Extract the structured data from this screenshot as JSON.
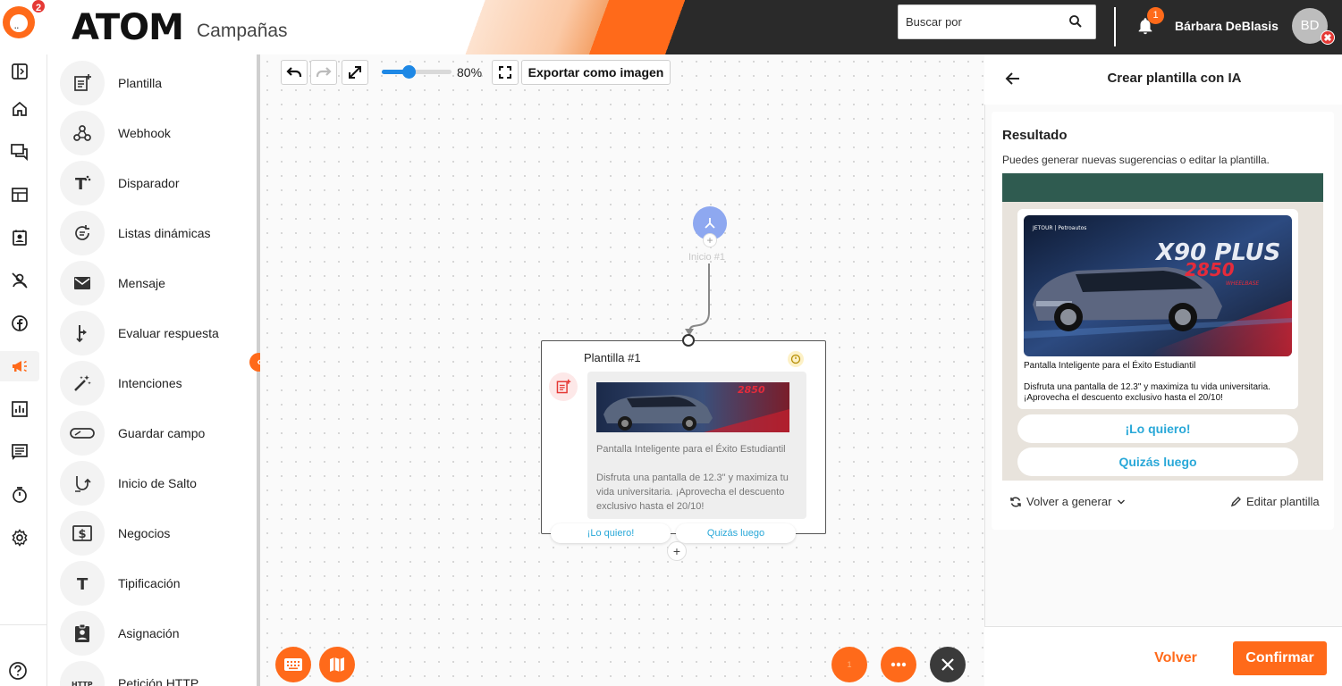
{
  "header": {
    "brand": "ATOM",
    "section": "Campañas",
    "logo_badge_count": "2",
    "search_placeholder": "Buscar por",
    "notification_count": "1",
    "user_name": "Bárbara DeBlasis",
    "user_initials": "BD"
  },
  "rail": {
    "icons": [
      "sidebar-toggle-icon",
      "home-icon",
      "conversations-icon",
      "table-icon",
      "contacts-icon",
      "agents-off-icon",
      "facebook-icon",
      "campaigns-icon",
      "reports-icon",
      "forms-icon",
      "timer-icon",
      "settings-icon",
      "help-icon"
    ],
    "active": "campaigns-icon"
  },
  "palette": {
    "items": [
      {
        "label": "Plantilla",
        "icon": "template-icon"
      },
      {
        "label": "Webhook",
        "icon": "webhook-icon"
      },
      {
        "label": "Disparador",
        "icon": "trigger-icon"
      },
      {
        "label": "Listas dinámicas",
        "icon": "dynamic-list-icon"
      },
      {
        "label": "Mensaje",
        "icon": "mail-icon"
      },
      {
        "label": "Evaluar respuesta",
        "icon": "branch-icon"
      },
      {
        "label": "Intenciones",
        "icon": "magic-wand-icon"
      },
      {
        "label": "Guardar campo",
        "icon": "input-field-icon"
      },
      {
        "label": "Inicio de Salto",
        "icon": "jump-icon"
      },
      {
        "label": "Negocios",
        "icon": "dollar-icon"
      },
      {
        "label": "Tipificación",
        "icon": "text-icon"
      },
      {
        "label": "Asignación",
        "icon": "assignment-icon"
      },
      {
        "label": "Petición HTTP",
        "icon": "http-icon"
      }
    ]
  },
  "toolbar": {
    "zoom_value": 80,
    "zoom_label": "80%",
    "export_label": "Exportar como imagen"
  },
  "canvas": {
    "start_label": "Inicio #1",
    "template_node": {
      "title": "Plantilla #1",
      "heading": "Pantalla Inteligente para el Éxito Estudiantil",
      "body": "Disfruta una pantalla de 12.3\" y maximiza tu vida universitaria. ¡Aprovecha el descuento exclusivo hasta el 20/10!",
      "buttons": [
        "¡Lo quiero!",
        "Quizás luego"
      ]
    },
    "fab_count": "1"
  },
  "panel": {
    "title": "Crear plantilla con IA",
    "result_title": "Resultado",
    "result_subtitle": "Puedes generar nuevas sugerencias o editar la plantilla.",
    "preview": {
      "image_caption_brand": "JETOUR | Petroautos",
      "image_model": "X90 PLUS",
      "image_badge": "2850",
      "image_badge_sub": "WHEELBASE",
      "heading": "Pantalla Inteligente para el Éxito Estudiantil",
      "body": "Disfruta una pantalla de 12.3\" y maximiza tu vida universitaria. ¡Aprovecha el descuento exclusivo hasta el 20/10!",
      "buttons": [
        "¡Lo quiero!",
        "Quizás luego"
      ]
    },
    "regenerate_label": "Volver a generar",
    "edit_label": "Editar plantilla",
    "back_label": "Volver",
    "confirm_label": "Confirmar"
  },
  "colors": {
    "accent": "#ff6a1a",
    "header_dark": "#2a2a2a",
    "whatsapp_bar": "#2f5b50",
    "link_blue": "#29a8d8",
    "start_node": "#8ea8f0"
  }
}
